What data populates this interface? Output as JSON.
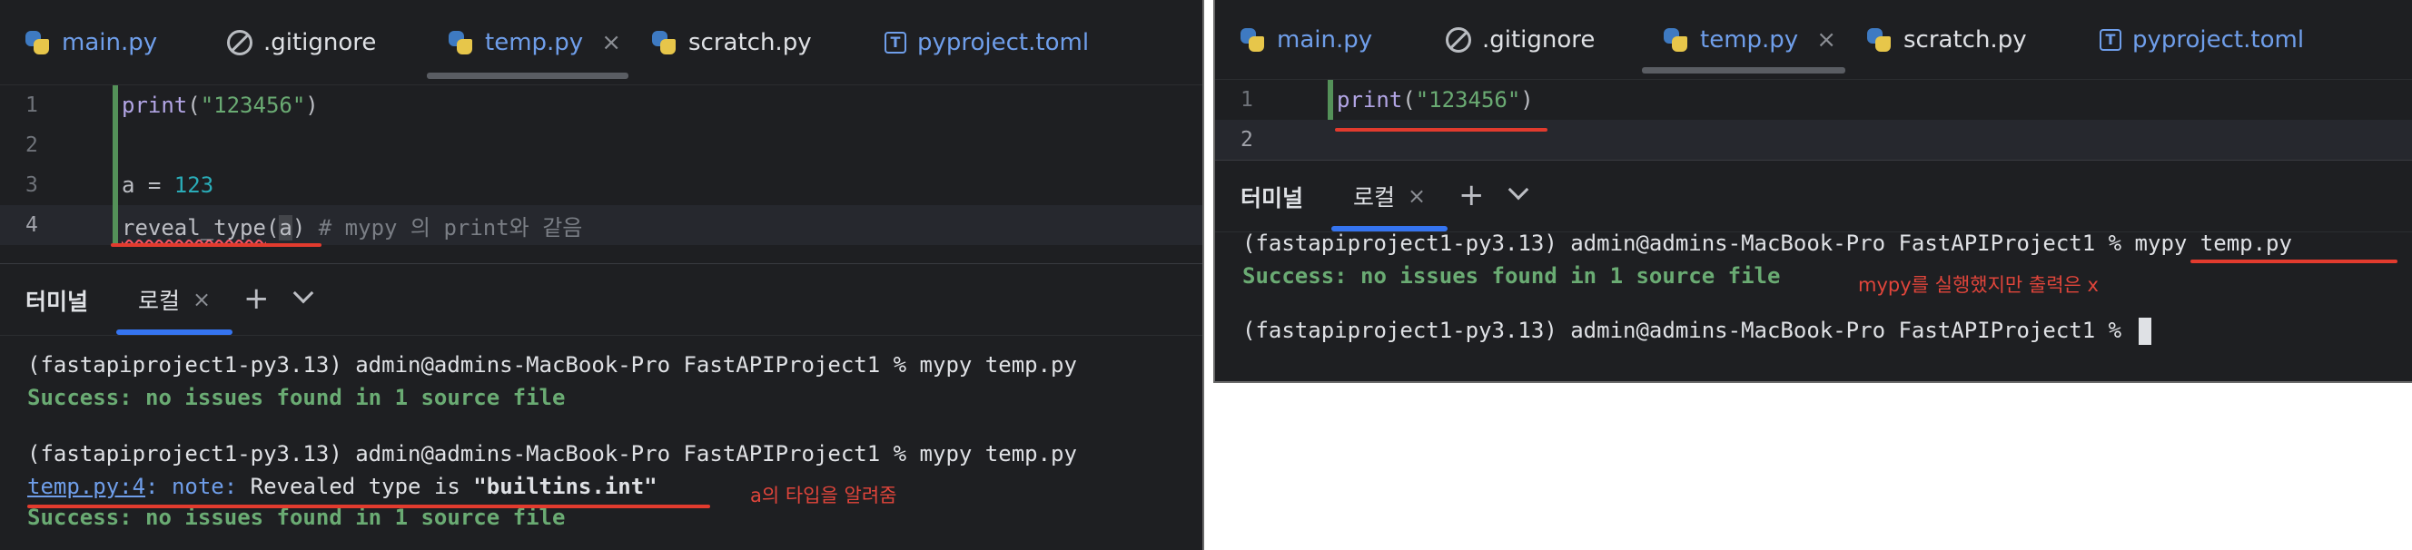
{
  "tabs": [
    {
      "label": "main.py",
      "icon": "python-file-icon"
    },
    {
      "label": ".gitignore",
      "icon": "gitignore-file-icon"
    },
    {
      "label": "temp.py",
      "icon": "python-file-icon",
      "active": true,
      "close": "×"
    },
    {
      "label": "scratch.py",
      "icon": "python-file-icon"
    },
    {
      "label": "pyproject.toml",
      "icon": "toml-file-icon",
      "icon_glyph": "T"
    }
  ],
  "left": {
    "code_lines": [
      {
        "num": "1",
        "text": "print(\"123456\")"
      },
      {
        "num": "2",
        "text": ""
      },
      {
        "num": "3",
        "text": "a = 123"
      },
      {
        "num": "4",
        "text": "reveal_type(a) # mypy 의 print와 같음"
      }
    ],
    "terminal_lines": [
      "(fastapiproject1-py3.13) admin@admins-MacBook-Pro FastAPIProject1 % mypy temp.py",
      "Success: no issues found in 1 source file",
      "(fastapiproject1-py3.13) admin@admins-MacBook-Pro FastAPIProject1 % mypy temp.py",
      {
        "link": "temp.py:4",
        "note": ": note:",
        "text": " Revealed type is ",
        "bold": "\"builtins.int\""
      },
      "Success: no issues found in 1 source file"
    ],
    "annotation": "a의 타입을 알려줌"
  },
  "right": {
    "code_lines": [
      {
        "num": "1",
        "text": "print(\"123456\")"
      },
      {
        "num": "2",
        "text": ""
      }
    ],
    "terminal_lines": [
      "(fastapiproject1-py3.13) admin@admins-MacBook-Pro FastAPIProject1 % mypy temp.py",
      "Success: no issues found in 1 source file",
      "(fastapiproject1-py3.13) admin@admins-MacBook-Pro FastAPIProject1 % "
    ],
    "annotation": "mypy를 실행했지만 출력은 x"
  },
  "terminal": {
    "title": "터미널",
    "tab_label": "로컬",
    "tab_close": "×",
    "add_button": "+",
    "dropdown_icon": "chevron-down-icon"
  },
  "colors": {
    "editor_bg": "#1e1f22",
    "accent_blue": "#3574f0",
    "success_green": "#6aab73",
    "annotation_red": "#e23b2e"
  }
}
